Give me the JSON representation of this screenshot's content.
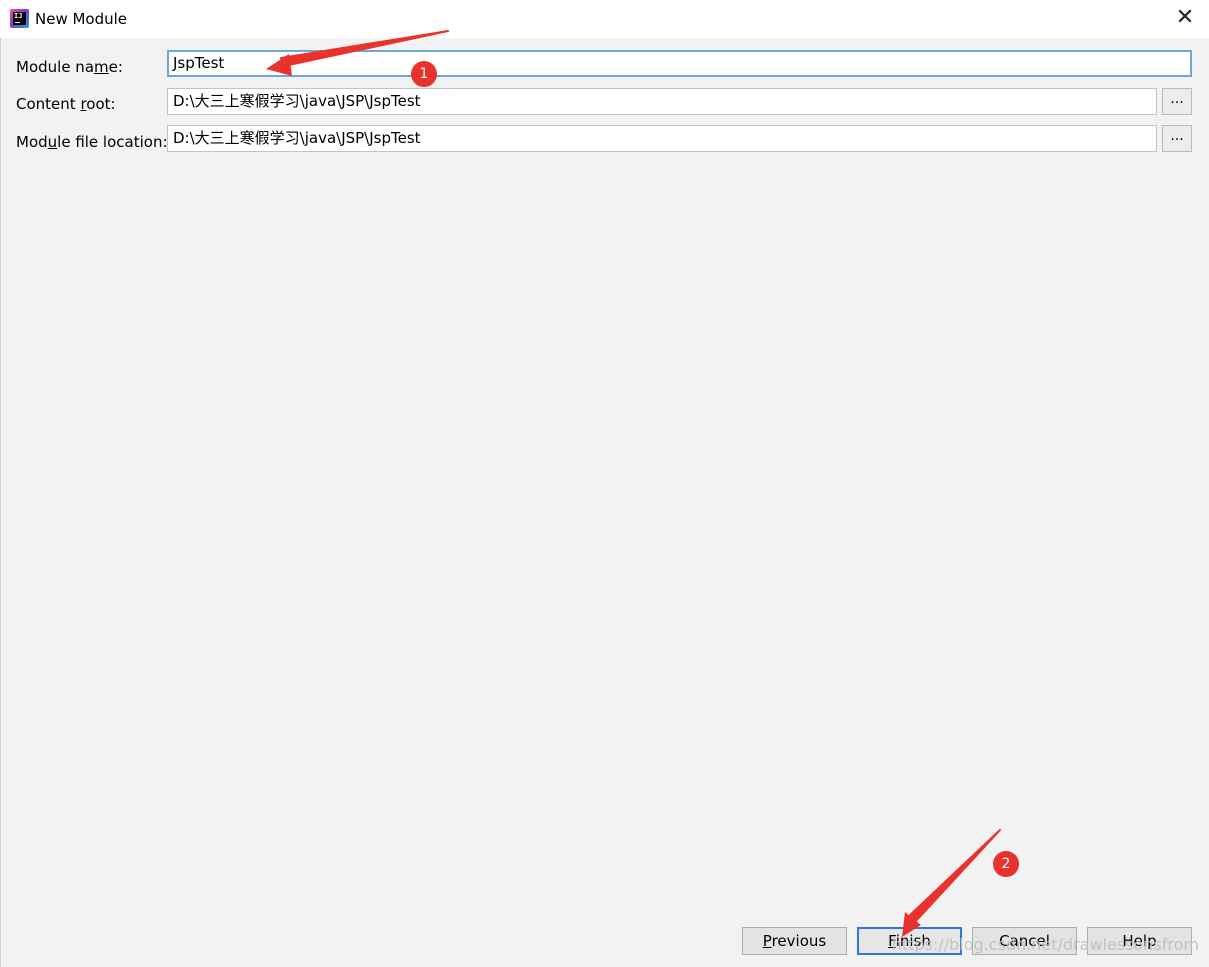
{
  "window": {
    "title": "New Module",
    "close_glyph": "✕"
  },
  "form": {
    "module_name": {
      "label_pre": "Module na",
      "label_mnemonic": "m",
      "label_post": "e:",
      "value": "JspTest"
    },
    "content_root": {
      "label_pre": "Content ",
      "label_mnemonic": "r",
      "label_post": "oot:",
      "value": "D:\\大三上寒假学习\\java\\JSP\\JspTest",
      "browse_label": "..."
    },
    "module_file_location": {
      "label_pre": "Mod",
      "label_mnemonic": "u",
      "label_post": "le file location:",
      "value": "D:\\大三上寒假学习\\java\\JSP\\JspTest",
      "browse_label": "..."
    }
  },
  "buttons": {
    "previous": {
      "mnemonic": "P",
      "rest": "revious"
    },
    "finish": {
      "mnemonic": "F",
      "rest": "inish"
    },
    "cancel": {
      "label": "Cancel"
    },
    "help": {
      "label": "Help"
    }
  },
  "annotations": {
    "badge_1": "1",
    "badge_2": "2",
    "arrow_color": "#e8322b"
  },
  "watermark": "https://blog.csdn.net/drawlessonsfrom",
  "colors": {
    "focus_border": "#6ca8e0",
    "default_button_border": "#2b7bd2",
    "dialog_bg": "#f2f2f2"
  }
}
